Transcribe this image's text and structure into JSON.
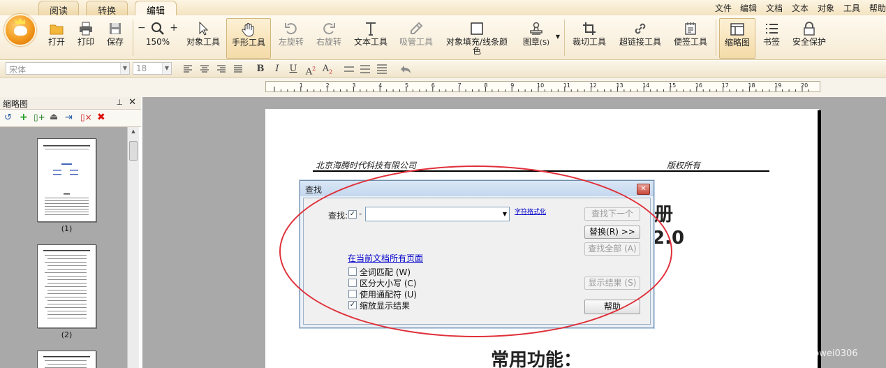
{
  "tabs": [
    "阅读",
    "转换",
    "编辑"
  ],
  "menu": [
    "文件",
    "编辑",
    "文档",
    "文本",
    "对象",
    "工具",
    "帮助"
  ],
  "toolbar": {
    "open": "打开",
    "print": "打印",
    "save": "保存",
    "zoom": "150%",
    "object_tool": "对象工具",
    "hand_tool": "手形工具",
    "rotate_left": "左旋转",
    "rotate_right": "右旋转",
    "text_tool": "文本工具",
    "eyedropper_tool": "吸管工具",
    "fill_line": "对象填充/线条颜色",
    "stamp": "图章",
    "stamp_shortcut": "(S)",
    "crop_tool": "裁切工具",
    "hyperlink_tool": "超链接工具",
    "note_tool": "便签工具",
    "thumbnail": "缩略图",
    "bookmark": "书签",
    "security": "安全保护"
  },
  "format": {
    "font": "宋体",
    "size": "18"
  },
  "thumbnail_panel": {
    "title": "缩略图",
    "labels": [
      "(1)",
      "(2)"
    ]
  },
  "document": {
    "header_left": "北京海腾时代科技有限公司",
    "header_right": "版权所有",
    "title_partial": "册",
    "version_partial": "2.0",
    "section": "常用功能："
  },
  "find_dialog": {
    "title": "查找",
    "find_label": "查找:",
    "dash": "-",
    "format_link": "字符格式化",
    "scope_link": "在当前文档所有页面",
    "options": [
      {
        "label": "全词匹配 (W)",
        "checked": false
      },
      {
        "label": "区分大小写 (C)",
        "checked": false
      },
      {
        "label": "使用通配符 (U)",
        "checked": false
      },
      {
        "label": "缩放显示结果",
        "checked": true
      }
    ],
    "buttons": {
      "find_next": "查找下一个",
      "replace": "替换(R) >>",
      "find_all": "查找全部 (A)",
      "show_results": "显示结果 (S)",
      "help": "帮助"
    }
  },
  "watermark": "https://blog.csdn.net/cocowei0306",
  "colors": {
    "annotation": "#e0303a",
    "accent": "#f39a1e",
    "link": "#0000cc"
  }
}
